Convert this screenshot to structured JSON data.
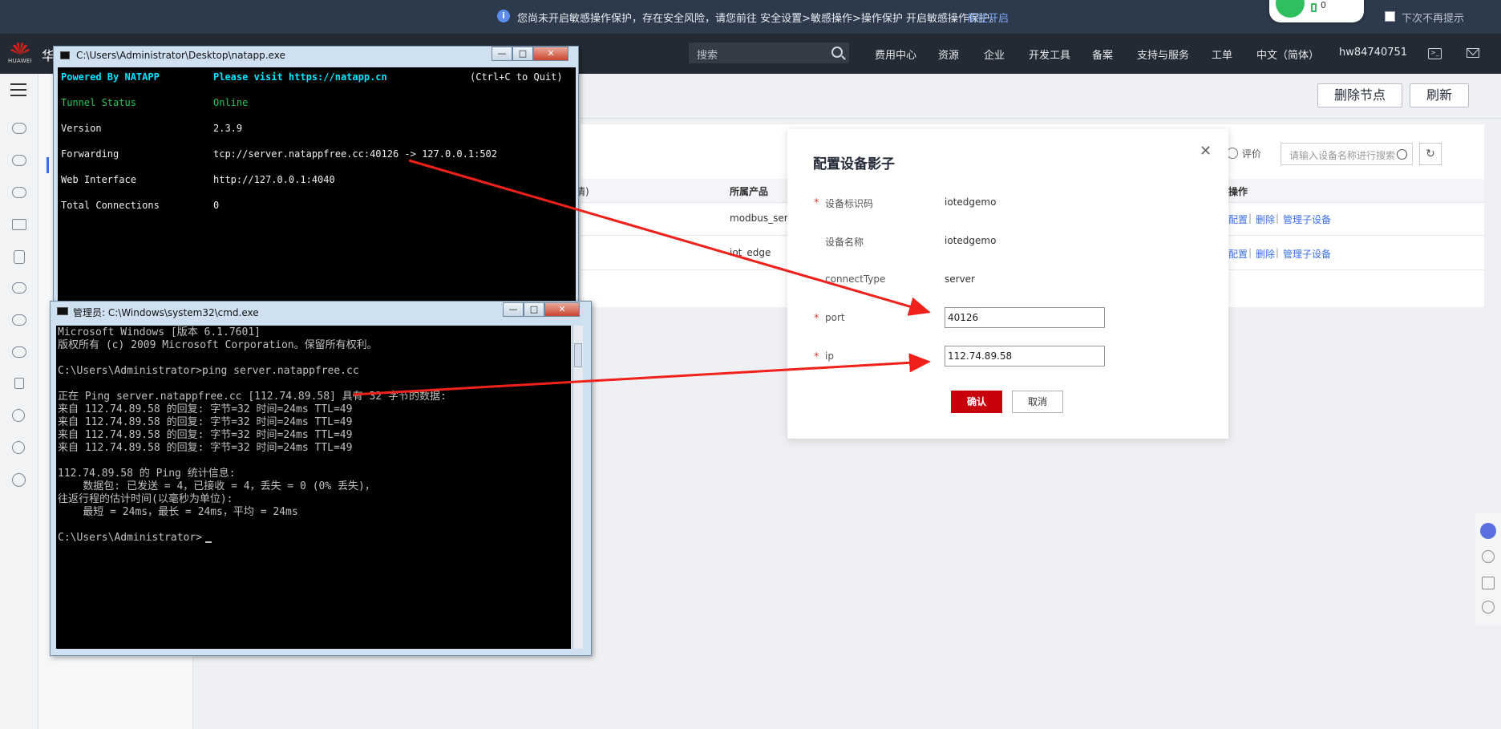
{
  "banner": {
    "message": "您尚未开启敏感操作保护，存在安全风险，请您前往 安全设置>敏感操作>操作保护 开启敏感操作保护。",
    "action": "前往开启",
    "dont_show": "下次不再提示",
    "wifi_count": "0"
  },
  "nav": {
    "logo_text": "HUAWEI",
    "brand": "华",
    "search_placeholder": "搜索",
    "items": [
      "费用中心",
      "资源",
      "企业",
      "开发工具",
      "备案",
      "支持与服务",
      "工单",
      "中文（简体）",
      "hw84740751"
    ]
  },
  "toolbar": {
    "delete_node": "删除节点",
    "refresh": "刷新"
  },
  "list": {
    "rate": "评价",
    "search_placeholder": "请输入设备名称进行搜索",
    "headers": {
      "partial": "情)",
      "product": "所属产品",
      "ops": "操作"
    },
    "rows": [
      {
        "product": "modbus_serv",
        "ops": [
          "配置",
          "删除",
          "管理子设备"
        ]
      },
      {
        "product": "iot_edge",
        "ops": [
          "配置",
          "删除",
          "管理子设备"
        ]
      }
    ]
  },
  "modal": {
    "title": "配置设备影子",
    "fields": [
      {
        "label": "设备标识码",
        "value": "iotedgemo",
        "required": true
      },
      {
        "label": "设备名称",
        "value": "iotedgemo",
        "required": false
      },
      {
        "label": "connectType",
        "value": "server",
        "required": false
      },
      {
        "label": "port",
        "value": "40126",
        "required": true
      },
      {
        "label": "ip",
        "value": "112.74.89.58",
        "required": true
      }
    ],
    "confirm": "确认",
    "cancel": "取消"
  },
  "natapp": {
    "title": "C:\\Users\\Administrator\\Desktop\\natapp.exe",
    "header_left": "Powered By NATAPP",
    "header_mid": "Please visit https://natapp.cn",
    "header_right": "(Ctrl+C to Quit)",
    "rows": [
      {
        "key": "Tunnel Status",
        "value": "Online"
      },
      {
        "key": "Version",
        "value": "2.3.9"
      },
      {
        "key": "Forwarding",
        "value": "tcp://server.natappfree.cc:40126 -> 127.0.0.1:502"
      },
      {
        "key": "Web Interface",
        "value": "http://127.0.0.1:4040"
      },
      {
        "key": "Total Connections",
        "value": "0"
      }
    ]
  },
  "cmd": {
    "title": "管理员: C:\\Windows\\system32\\cmd.exe",
    "lines": [
      "Microsoft Windows [版本 6.1.7601]",
      "版权所有 (c) 2009 Microsoft Corporation。保留所有权利。",
      "",
      "C:\\Users\\Administrator>ping server.natappfree.cc",
      "",
      "正在 Ping server.natappfree.cc [112.74.89.58] 具有 32 字节的数据:",
      "来自 112.74.89.58 的回复: 字节=32 时间=24ms TTL=49",
      "来自 112.74.89.58 的回复: 字节=32 时间=24ms TTL=49",
      "来自 112.74.89.58 的回复: 字节=32 时间=24ms TTL=49",
      "来自 112.74.89.58 的回复: 字节=32 时间=24ms TTL=49",
      "",
      "112.74.89.58 的 Ping 统计信息:",
      "    数据包: 已发送 = 4，已接收 = 4，丢失 = 0 (0% 丢失)，",
      "往返行程的估计时间(以毫秒为单位):",
      "    最短 = 24ms，最长 = 24ms，平均 = 24ms",
      "",
      "C:\\Users\\Administrator>"
    ]
  },
  "colors": {
    "banner_bg": "#2d3a4b",
    "nav_bg": "#242a33",
    "brand_red": "#c7000b",
    "link_blue": "#3a6fe8",
    "arrow_red": "#f0211a",
    "natapp_cyan": "#00e5ff",
    "natapp_green": "#22c55e"
  },
  "icons": [
    "info-icon",
    "wifi-icon",
    "battery-icon",
    "huawei-logo",
    "search-icon",
    "terminal-icon",
    "mail-icon",
    "menu-icon",
    "close-icon",
    "rate-icon",
    "refresh-icon",
    "support-icon",
    "help-icon",
    "feedback-icon",
    "smile-icon"
  ]
}
